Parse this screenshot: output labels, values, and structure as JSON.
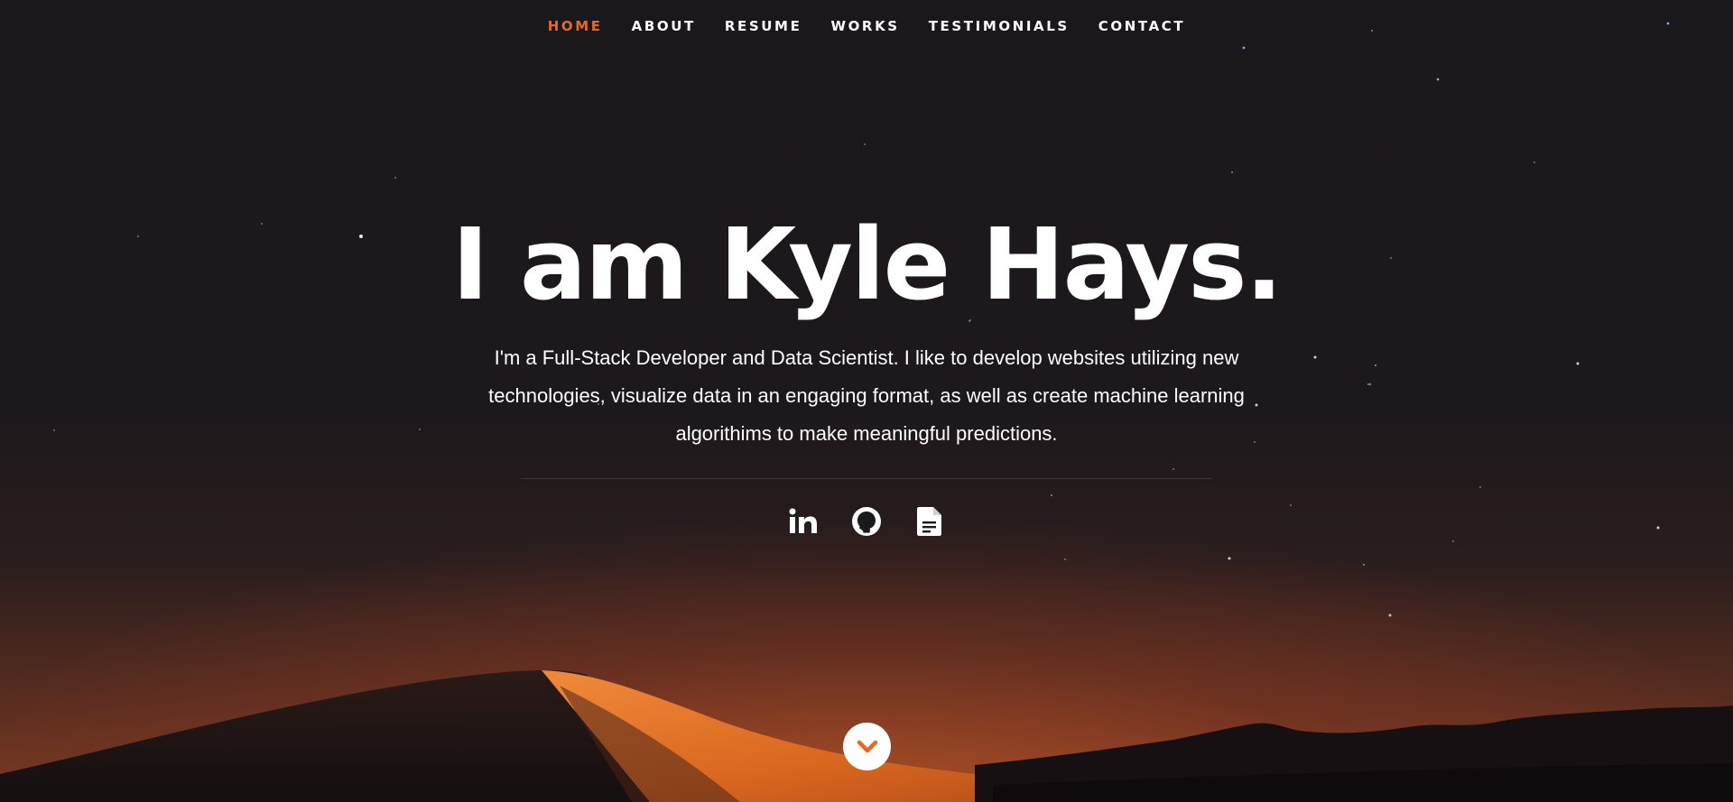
{
  "nav": {
    "items": [
      {
        "label": "HOME",
        "active": true
      },
      {
        "label": "ABOUT",
        "active": false
      },
      {
        "label": "RESUME",
        "active": false
      },
      {
        "label": "WORKS",
        "active": false
      },
      {
        "label": "TESTIMONIALS",
        "active": false
      },
      {
        "label": "CONTACT",
        "active": false
      }
    ]
  },
  "banner": {
    "headline": "I am Kyle Hays.",
    "intro": "I'm a Full-Stack Developer and Data Scientist. I like to develop websites utilizing new technologies, visualize data in an engaging format, as well as create machine learning algorithims to make meaningful predictions."
  },
  "social": {
    "icons": [
      "linkedin-icon",
      "github-icon",
      "document-icon"
    ]
  },
  "scroll": {
    "icon": "chevron-down-icon"
  },
  "colors": {
    "accent": "#e8691e",
    "background": "#1b181b",
    "text": "#ffffff"
  }
}
